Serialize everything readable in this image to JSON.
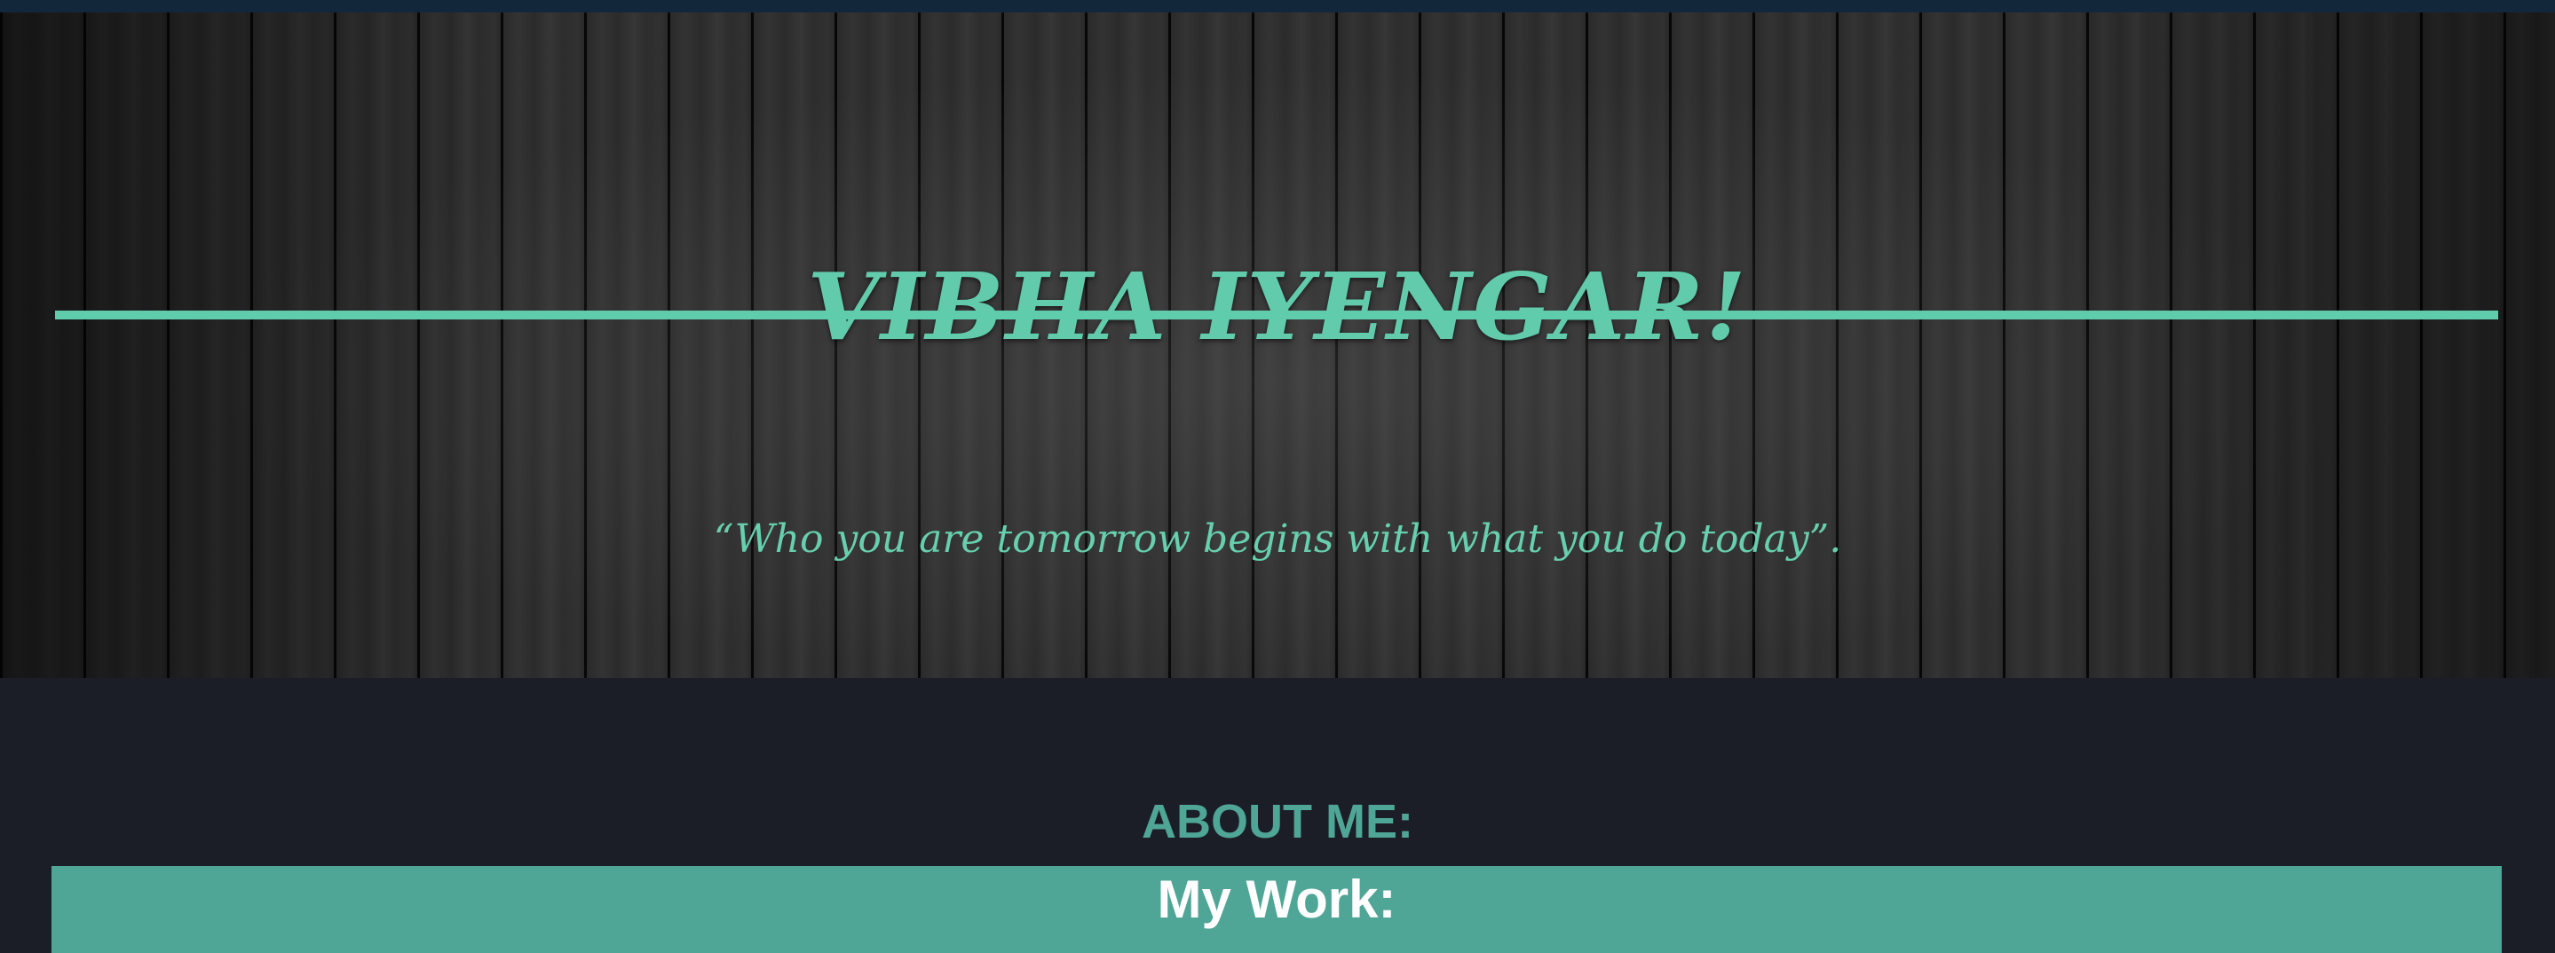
{
  "header": {
    "name": "VIBHA IYENGAR!",
    "quote": "“Who you are tomorrow begins with what you do today”."
  },
  "sections": {
    "about": "ABOUT ME:",
    "work": "My Work:"
  },
  "colors": {
    "accent": "#5fcdab",
    "section_heading": "#4fa596",
    "work_bar": "#50a696",
    "page_background": "#1b1e26",
    "top_strip": "#13273a"
  }
}
